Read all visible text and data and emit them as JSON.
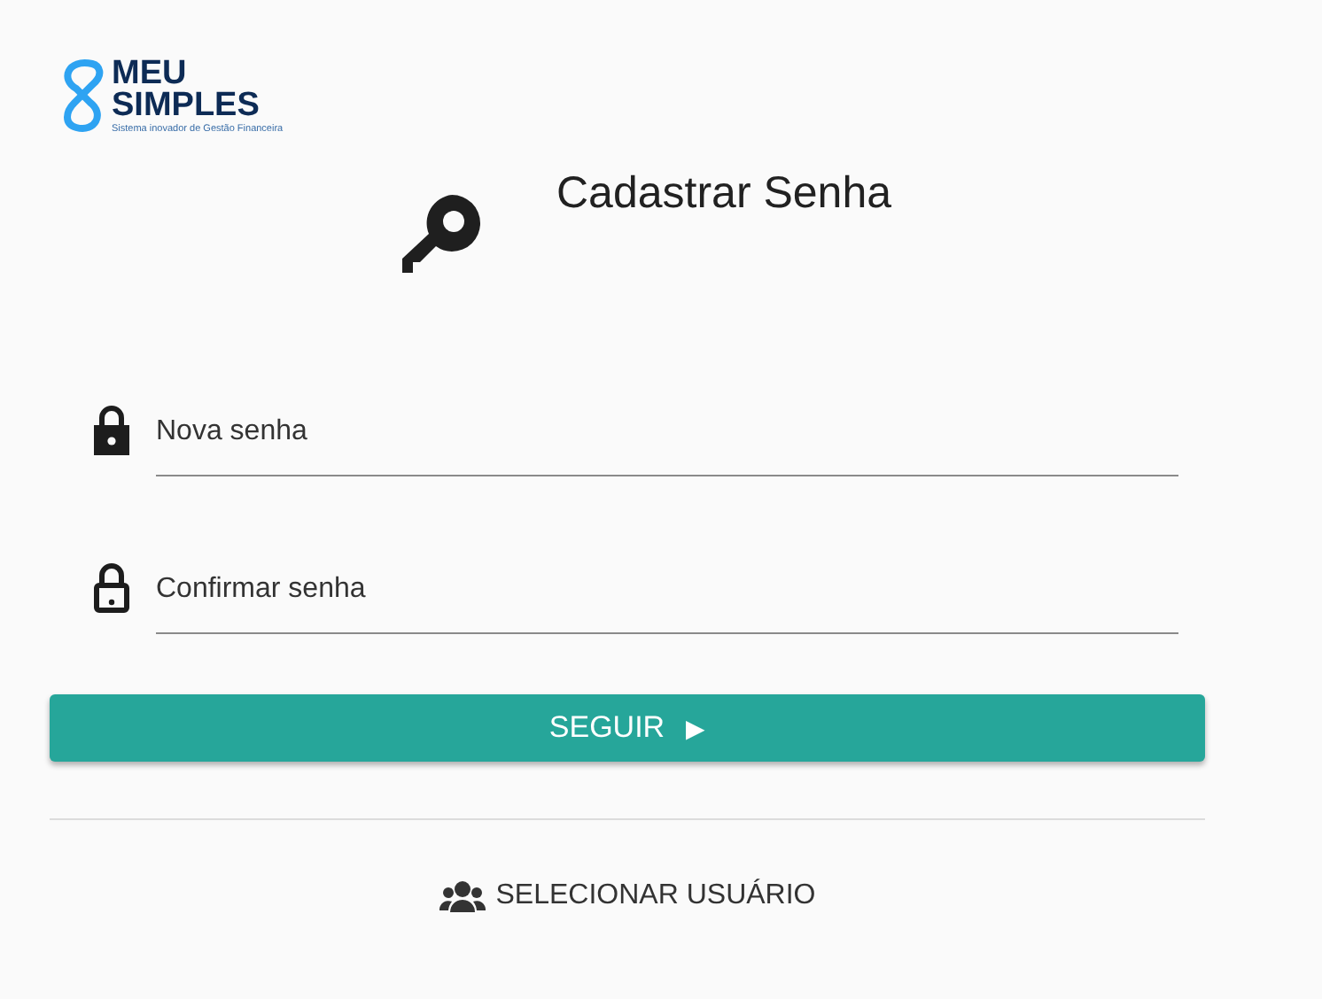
{
  "logo": {
    "line_1": "MEU",
    "line_2": "SIMPLES",
    "tagline": "Sistema inovador de Gestão Financeira"
  },
  "title": "Cadastrar Senha",
  "fields": [
    {
      "kind": "filled",
      "placeholder": "Nova senha"
    },
    {
      "kind": "outline",
      "placeholder": "Confirmar senha"
    }
  ],
  "submit_button": {
    "label": "SEGUIR",
    "arrow": "▶"
  },
  "select_user_link": "SELECIONAR USUÁRIO"
}
